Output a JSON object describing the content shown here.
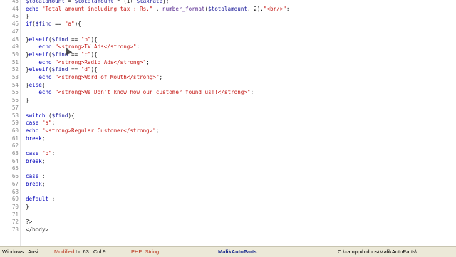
{
  "editor": {
    "lines": [
      {
        "n": "43",
        "c": "$totalamount = $totalamount * (1+ $taxrate);"
      },
      {
        "n": "44",
        "c": "echo \"Total amount including tax : Rs.\" . number_format($totalamount, 2).\"<br/>\";"
      },
      {
        "n": "45",
        "c": "}"
      },
      {
        "n": "46",
        "c": "if($find == \"a\"){"
      },
      {
        "n": "47",
        "c": ""
      },
      {
        "n": "48",
        "c": "}elseif($find == \"b\"){"
      },
      {
        "n": "49",
        "c": "    echo \"<strong>TV Ads</strong>\";"
      },
      {
        "n": "50",
        "c": "}elseif($find == \"c\"){"
      },
      {
        "n": "51",
        "c": "    echo \"<strong>Radio Ads</strong>\";"
      },
      {
        "n": "52",
        "c": "}elseif($find == \"d\"){"
      },
      {
        "n": "53",
        "c": "    echo \"<strong>Word of Mouth</strong>\";"
      },
      {
        "n": "54",
        "c": "}else{"
      },
      {
        "n": "55",
        "c": "    echo \"<strong>We Don't know how our customer found us!!</strong>\";"
      },
      {
        "n": "56",
        "c": "}"
      },
      {
        "n": "57",
        "c": ""
      },
      {
        "n": "58",
        "c": "switch ($find){"
      },
      {
        "n": "59",
        "c": "case \"a\":"
      },
      {
        "n": "60",
        "c": "echo \"<strong>Regular Customer</strong>\";"
      },
      {
        "n": "61",
        "c": "break;"
      },
      {
        "n": "62",
        "c": ""
      },
      {
        "n": "63",
        "c": "case \"b\":"
      },
      {
        "n": "64",
        "c": "break;"
      },
      {
        "n": "65",
        "c": ""
      },
      {
        "n": "66",
        "c": "case :"
      },
      {
        "n": "67",
        "c": "break;"
      },
      {
        "n": "68",
        "c": ""
      },
      {
        "n": "69",
        "c": "default :"
      },
      {
        "n": "70",
        "c": "}"
      },
      {
        "n": "71",
        "c": ""
      },
      {
        "n": "72",
        "c": "?>"
      },
      {
        "n": "73",
        "c": "</body>"
      }
    ]
  },
  "status": {
    "line_ending": "Windows | Ansi",
    "modified": "Modified",
    "position": "Ln  63 : Col  9",
    "language": "PHP: String",
    "project": "MalikAutoParts",
    "path": "C:\\xampp\\htdocs\\MalikAutoParts\\"
  }
}
